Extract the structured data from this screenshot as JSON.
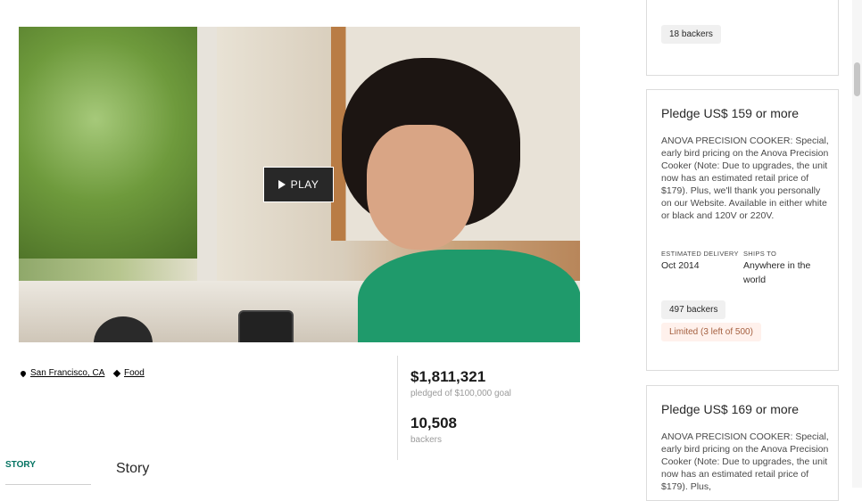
{
  "video": {
    "play_label": "PLAY"
  },
  "meta": {
    "location": "San Francisco, CA",
    "category": "Food"
  },
  "stats": {
    "pledged": "$1,811,321",
    "goal_text": "pledged of $100,000 goal",
    "backers": "10,508",
    "backers_label": "backers"
  },
  "story": {
    "tab_label": "STORY",
    "heading": "Story"
  },
  "rewards": {
    "top": {
      "backers": "18 backers"
    },
    "r159": {
      "title": "Pledge US$ 159 or more",
      "description": "ANOVA PRECISION COOKER: Special, early bird pricing on the Anova Precision Cooker (Note: Due to upgrades, the unit now has an estimated retail price of $179). Plus, we'll thank you personally on our Website. Available in either white or black and 120V or 220V.",
      "delivery_label": "ESTIMATED DELIVERY",
      "delivery_value": "Oct 2014",
      "ships_label": "SHIPS TO",
      "ships_value": "Anywhere in the world",
      "backers": "497 backers",
      "limited": "Limited (3 left of 500)"
    },
    "r169": {
      "title": "Pledge US$ 169 or more",
      "description": "ANOVA PRECISION COOKER: Special, early bird pricing on the Anova Precision Cooker (Note: Due to upgrades, the unit now has an estimated retail price of $179). Plus,"
    }
  },
  "colors": {
    "accent": "#037362",
    "dark": "#282828",
    "border": "#dcdcdc",
    "limited_bg": "#fff1ec"
  },
  "icons": {
    "location": "map-pin-icon",
    "category": "tag-icon",
    "play": "play-icon"
  }
}
